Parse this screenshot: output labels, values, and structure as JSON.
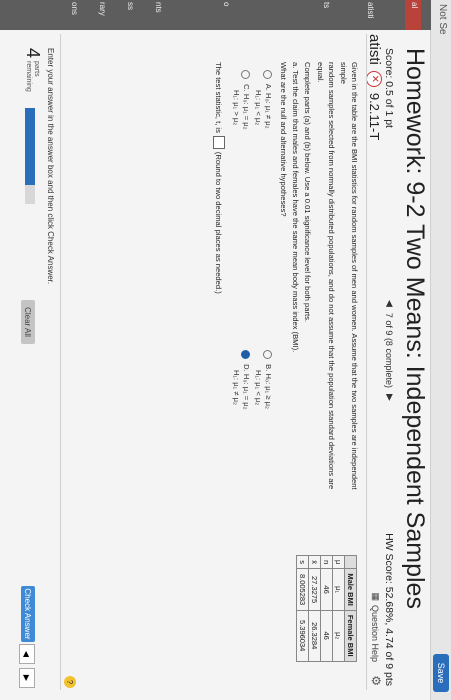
{
  "browser": {
    "not_secure": "Not Se",
    "save_label": "Save"
  },
  "side_labels": [
    "al",
    "atisti",
    "ts",
    "o",
    "nts",
    "ss",
    "rary",
    "ons"
  ],
  "header": {
    "title": "Homework: 9-2 Two Means: Independent Samples",
    "score": "Score: 0.5 of 1 pt",
    "hw_score": "HW Score: 52.68%, 4.74 of 9 pts",
    "question_nav": "7 of 9 (8 complete)",
    "question_id_prefix": "atisti",
    "question_id": "9.2.11-T",
    "question_help": "Question Help"
  },
  "problem": {
    "line1": "Given in the table are the BMI statistics for random samples of men and women. Assume that the two samples are independent simple",
    "line2": "random samples selected from normally distributed populations, and do not assume that the population standard deviations are equal.",
    "line3": "Complete parts (a) and (b) below. Use a 0.01 significance level for both parts."
  },
  "table": {
    "headers": [
      "",
      "Male BMI",
      "Female BMI"
    ],
    "rows": [
      [
        "μ",
        "μ₁",
        "μ₂"
      ],
      [
        "n",
        "46",
        "46"
      ],
      [
        "x̄",
        "27.3275",
        "26.3284"
      ],
      [
        "s",
        "8.005283",
        "5.396034"
      ]
    ]
  },
  "part_a": {
    "label": "a. Test the claim that males and females have the same mean body mass index (BMI).",
    "prompt": "What are the null and alternative hypotheses?",
    "options": [
      {
        "letter": "A.",
        "h0": "H₀: μ₁ ≠ μ₂",
        "h1": "H₁: μ₁ < μ₂",
        "checked": false
      },
      {
        "letter": "B.",
        "h0": "H₀: μ₁ ≥ μ₂",
        "h1": "H₁: μ₁ < μ₂",
        "checked": false
      },
      {
        "letter": "C.",
        "h0": "H₀: μ₁ = μ₂",
        "h1": "H₁: μ₁ > μ₂",
        "checked": false
      },
      {
        "letter": "D.",
        "h0": "H₀: μ₁ = μ₂",
        "h1": "H₁: μ₁ ≠ μ₂",
        "checked": true
      }
    ],
    "test_stat_prefix": "The test statistic, t, is",
    "test_stat_suffix": "(Round to two decimal places as needed.)"
  },
  "footer": {
    "instruction": "Enter your answer in the answer box and then click Check Answer.",
    "parts_number": "4",
    "parts_label1": "parts",
    "parts_label2": "remaining",
    "progress": 0.8,
    "clear_all": "Clear All",
    "check_answer": "Check Answer",
    "help_glyph": "?",
    "prev_glyph": "◀",
    "next_glyph": "▶"
  },
  "icons": {
    "badge": "✕",
    "gear": "⚙",
    "grid": "▦",
    "question_prev": "◀",
    "question_next": "▶"
  },
  "colors": {
    "accent": "#2a6ebb",
    "check": "#3e8ad6",
    "error": "#c33333"
  }
}
